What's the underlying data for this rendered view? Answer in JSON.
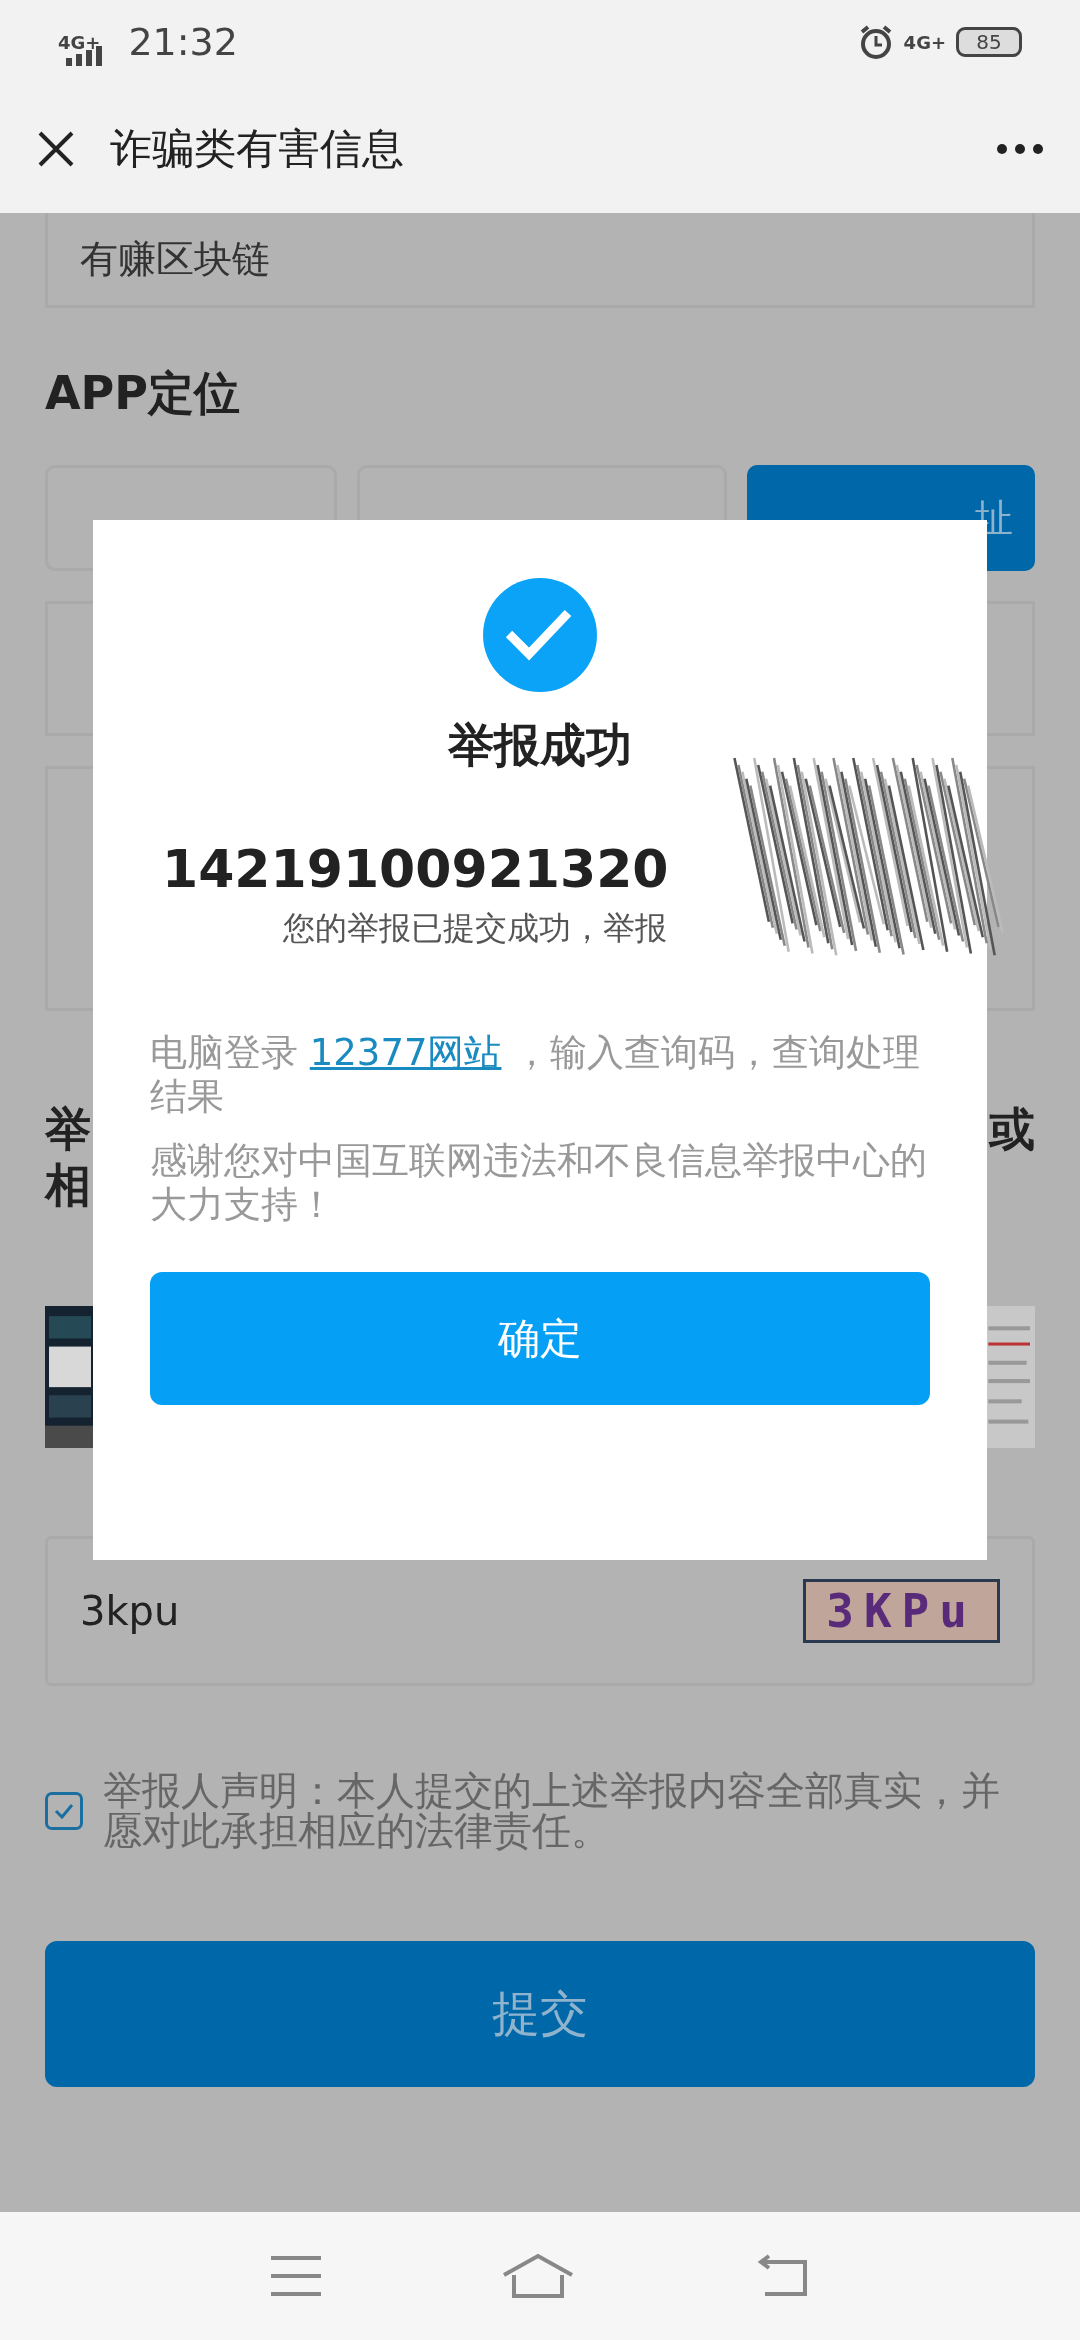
{
  "status_bar": {
    "network_left": "4G+",
    "time": "21:32",
    "network_right": "4G+",
    "battery": "85"
  },
  "header": {
    "title": "诈骗类有害信息"
  },
  "form": {
    "app_name_value": "有赚区块链",
    "section_title": "APP定位",
    "locate_button": "址",
    "evidence_heading": {
      "left_lines": [
        "举",
        "相"
      ],
      "right_lines": [
        "或"
      ]
    },
    "captcha": {
      "value": "3kpu",
      "image_text": "3KPu"
    },
    "declaration": {
      "checked": true,
      "text": "举报人声明：本人提交的上述举报内容全部真实，并愿对此承担相应的法律责任。"
    },
    "submit": "提交"
  },
  "dialog": {
    "title": "举报成功",
    "code": "14219100921320",
    "message": "您的举报已提交成功，举报",
    "hint_before": "电脑登录 ",
    "hint_link": "12377网站",
    "hint_after": " ，输入查询码，查询处理结果",
    "thanks": "感谢您对中国互联网违法和不良信息举报中心的大力支持！",
    "confirm": "确定"
  }
}
